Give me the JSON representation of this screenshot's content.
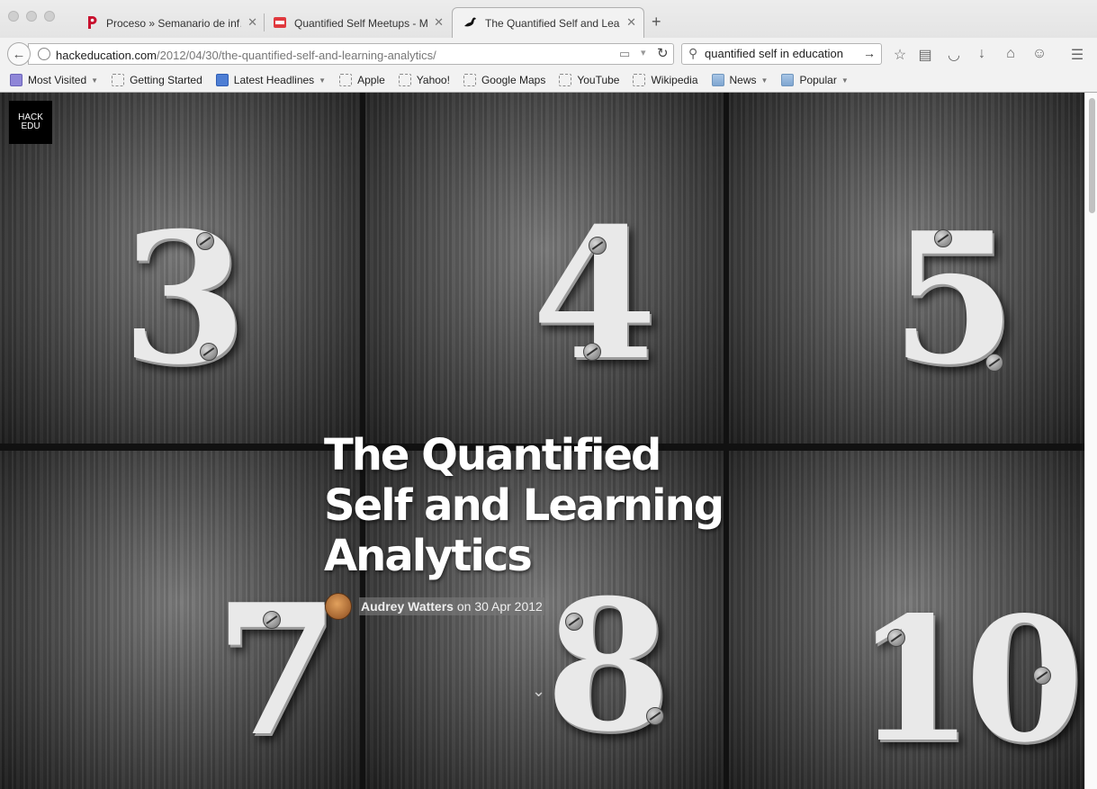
{
  "tabs": [
    {
      "title": "Proceso » Semanario de inf…",
      "icon": "proceso-favicon",
      "active": false
    },
    {
      "title": "Quantified Self Meetups - M…",
      "icon": "meetup-favicon",
      "active": false
    },
    {
      "title": "The Quantified Self and Lea…",
      "icon": "bird-favicon",
      "active": true
    }
  ],
  "navbar": {
    "url_host": "hackeducation.com",
    "url_path": "/2012/04/30/the-quantified-self-and-learning-analytics/",
    "search_value": "quantified self in education"
  },
  "bookmarks": [
    {
      "label": "Most Visited",
      "icon": "most-visited-icon",
      "dropdown": true
    },
    {
      "label": "Getting Started",
      "icon": "page-icon",
      "dropdown": false
    },
    {
      "label": "Latest Headlines",
      "icon": "rss-icon",
      "dropdown": true
    },
    {
      "label": "Apple",
      "icon": "page-icon",
      "dropdown": false
    },
    {
      "label": "Yahoo!",
      "icon": "page-icon",
      "dropdown": false
    },
    {
      "label": "Google Maps",
      "icon": "page-icon",
      "dropdown": false
    },
    {
      "label": "YouTube",
      "icon": "page-icon",
      "dropdown": false
    },
    {
      "label": "Wikipedia",
      "icon": "page-icon",
      "dropdown": false
    },
    {
      "label": "News",
      "icon": "folder-icon",
      "dropdown": true
    },
    {
      "label": "Popular",
      "icon": "folder-icon",
      "dropdown": true
    }
  ],
  "page": {
    "logo_line1": "HACK",
    "logo_line2": "EDU",
    "title": "The Quantified Self and Learning Analytics",
    "author": "Audrey Watters",
    "date_prefix": "on",
    "date": "30 Apr 2012",
    "hero_digits": [
      "3",
      "4",
      "5",
      "7",
      "8",
      "10"
    ]
  },
  "colors": {
    "headline": "#ffffff",
    "chrome": "#e4e4e4",
    "hero_tone": "#555555"
  }
}
